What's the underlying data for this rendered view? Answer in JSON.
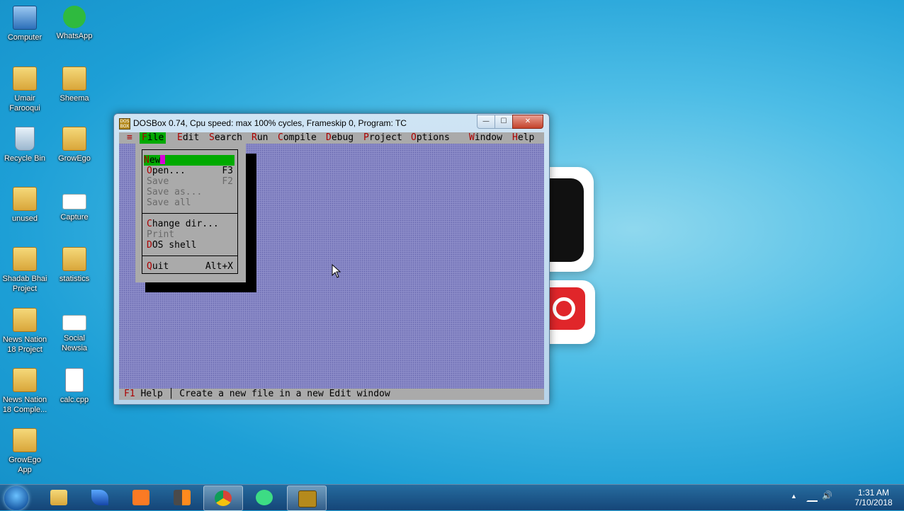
{
  "desktop": {
    "icons": [
      {
        "label": "Computer"
      },
      {
        "label": "WhatsApp"
      },
      {
        "label": "Umair\nFarooqui"
      },
      {
        "label": "Sheema"
      },
      {
        "label": "Recycle Bin"
      },
      {
        "label": "GrowEgo"
      },
      {
        "label": "unused"
      },
      {
        "label": "Capture"
      },
      {
        "label": "Shadab Bhai\nProject"
      },
      {
        "label": "statistics"
      },
      {
        "label": "News Nation\n18 Project"
      },
      {
        "label": "Social\nNewsia"
      },
      {
        "label": "News Nation\n18 Comple..."
      },
      {
        "label": "calc.cpp"
      },
      {
        "label": "GrowEgo\nApp"
      }
    ]
  },
  "window": {
    "title": "DOSBox 0.74, Cpu speed: max 100% cycles, Frameskip  0, Program:     TC",
    "min_label": "—",
    "max_label": "☐",
    "close_label": "✕"
  },
  "tc": {
    "menu": [
      {
        "label": "≡",
        "hot": "",
        "rest": "≡"
      },
      {
        "label": "File",
        "hot": "F",
        "rest": "ile"
      },
      {
        "label": "Edit",
        "hot": "E",
        "rest": "dit"
      },
      {
        "label": "Search",
        "hot": "S",
        "rest": "earch"
      },
      {
        "label": "Run",
        "hot": "R",
        "rest": "un"
      },
      {
        "label": "Compile",
        "hot": "C",
        "rest": "ompile"
      },
      {
        "label": "Debug",
        "hot": "D",
        "rest": "ebug"
      },
      {
        "label": "Project",
        "hot": "P",
        "rest": "roject"
      },
      {
        "label": "Options",
        "hot": "O",
        "rest": "ptions"
      },
      {
        "label": "Window",
        "hot": "W",
        "rest": "indow"
      },
      {
        "label": "Help",
        "hot": "H",
        "rest": "elp"
      }
    ],
    "file_menu": [
      {
        "hot": "N",
        "rest": "ew",
        "shortcut": ""
      },
      {
        "hot": "O",
        "rest": "pen...",
        "shortcut": "F3"
      },
      {
        "hot": "",
        "rest": "Save",
        "shortcut": "F2"
      },
      {
        "hot": "",
        "rest": "Save as...",
        "shortcut": ""
      },
      {
        "hot": "",
        "rest": "Save all",
        "shortcut": ""
      },
      {
        "hot": "C",
        "rest": "hange dir...",
        "shortcut": ""
      },
      {
        "hot": "",
        "rest": "Print",
        "shortcut": ""
      },
      {
        "hot": "D",
        "rest": "OS shell",
        "shortcut": ""
      },
      {
        "hot": "Q",
        "rest": "uit",
        "shortcut": "Alt+X"
      }
    ],
    "status": {
      "key": "F1",
      "help": " Help ",
      "sep": "│",
      "message": " Create a new file in a new Edit window"
    }
  },
  "taskbar": {
    "time": "1:31 AM",
    "date": "7/10/2018",
    "tray_arrow": "▲",
    "volume": "🔊"
  }
}
